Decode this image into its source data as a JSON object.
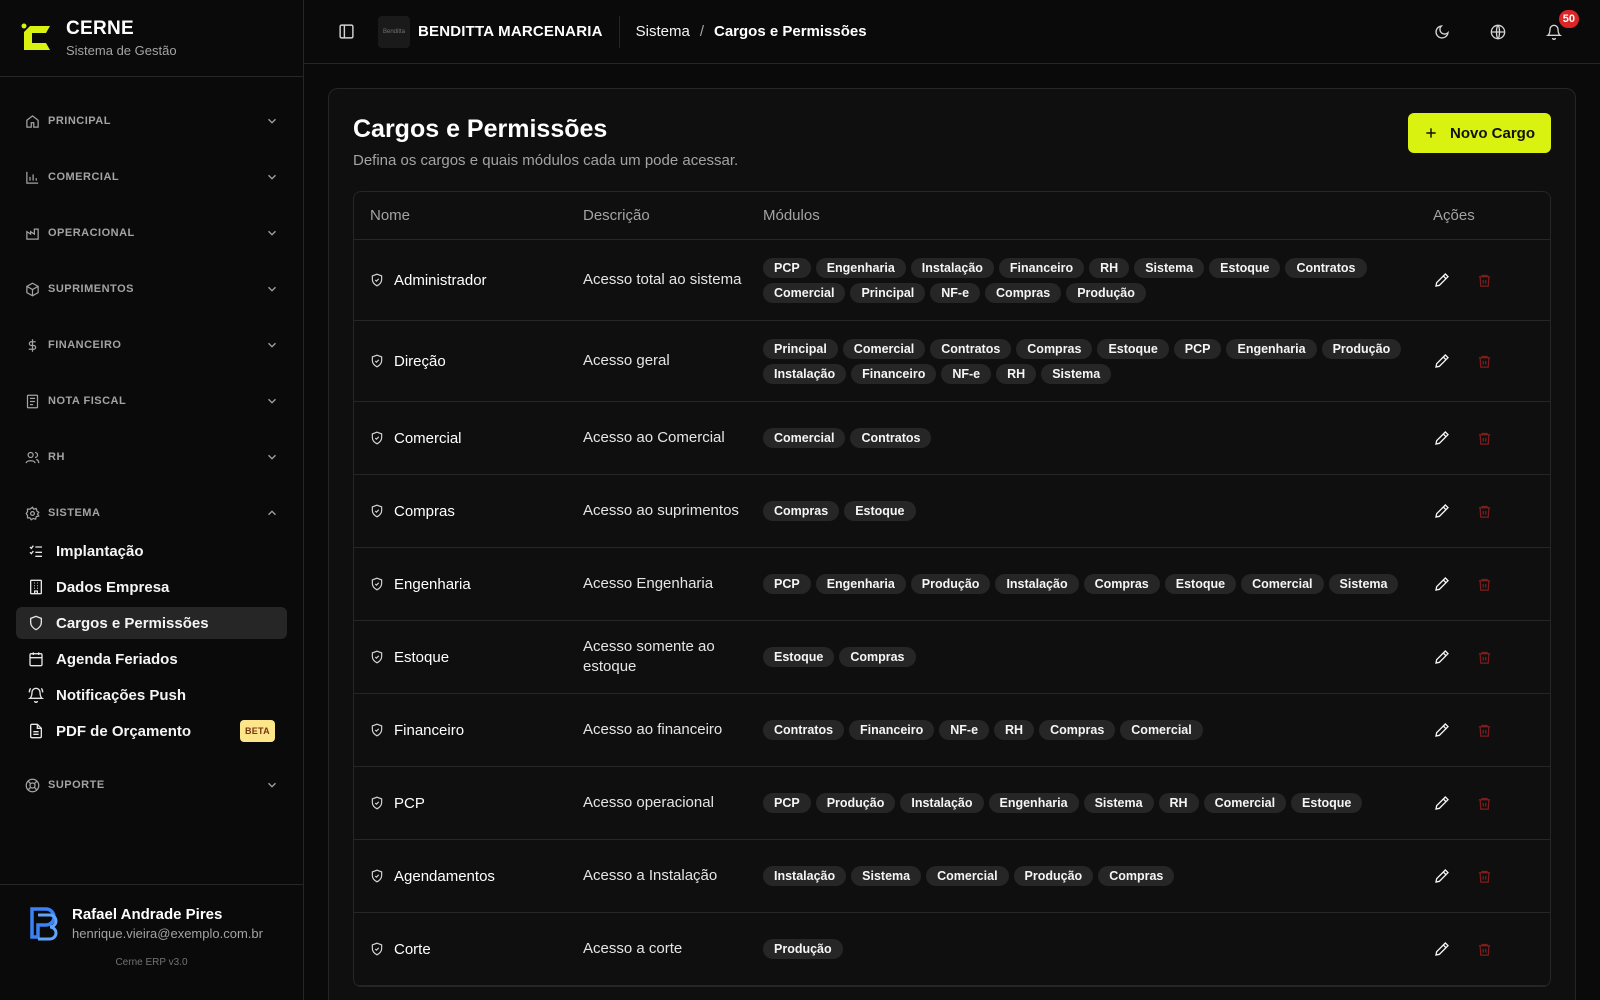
{
  "brand": {
    "name": "CERNE",
    "subtitle": "Sistema de Gestão"
  },
  "sidebar": {
    "sections": [
      {
        "label": "PRINCIPAL",
        "icon": "home-icon"
      },
      {
        "label": "COMERCIAL",
        "icon": "bar-chart-icon"
      },
      {
        "label": "OPERACIONAL",
        "icon": "factory-icon"
      },
      {
        "label": "SUPRIMENTOS",
        "icon": "package-icon"
      },
      {
        "label": "FINANCEIRO",
        "icon": "dollar-icon"
      },
      {
        "label": "NOTA FISCAL",
        "icon": "receipt-icon"
      },
      {
        "label": "RH",
        "icon": "users-icon"
      },
      {
        "label": "SISTEMA",
        "icon": "gear-icon"
      },
      {
        "label": "SUPORTE",
        "icon": "lifebuoy-icon"
      }
    ],
    "system_items": [
      {
        "label": "Implantação",
        "icon": "checklist-icon"
      },
      {
        "label": "Dados Empresa",
        "icon": "building-icon"
      },
      {
        "label": "Cargos e Permissões",
        "icon": "shield-icon",
        "active": true
      },
      {
        "label": "Agenda Feriados",
        "icon": "calendar-icon"
      },
      {
        "label": "Notificações Push",
        "icon": "bell-ring-icon"
      },
      {
        "label": "PDF de Orçamento",
        "icon": "file-icon",
        "badge": "BETA"
      }
    ]
  },
  "user": {
    "name": "Rafael Andrade Pires",
    "email": "henrique.vieira@exemplo.com.br"
  },
  "version": "Cerne ERP v3.0",
  "topbar": {
    "company": "BENDITTA MARCENARIA",
    "company_logo_text": "Benditta",
    "breadcrumb_root": "Sistema",
    "breadcrumb_sep": "/",
    "breadcrumb_current": "Cargos e Permissões",
    "notifications_count": "50"
  },
  "page": {
    "title": "Cargos e Permissões",
    "subtitle": "Defina os cargos e quais módulos cada um pode acessar.",
    "new_button": "Novo Cargo"
  },
  "table": {
    "headers": {
      "name": "Nome",
      "description": "Descrição",
      "modules": "Módulos",
      "actions": "Ações"
    },
    "rows": [
      {
        "name": "Administrador",
        "description": "Acesso total ao sistema",
        "modules": [
          "PCP",
          "Engenharia",
          "Instalação",
          "Financeiro",
          "RH",
          "Sistema",
          "Estoque",
          "Contratos",
          "Comercial",
          "Principal",
          "NF-e",
          "Compras",
          "Produção"
        ]
      },
      {
        "name": "Direção",
        "description": "Acesso geral",
        "modules": [
          "Principal",
          "Comercial",
          "Contratos",
          "Compras",
          "Estoque",
          "PCP",
          "Engenharia",
          "Produção",
          "Instalação",
          "Financeiro",
          "NF-e",
          "RH",
          "Sistema"
        ]
      },
      {
        "name": "Comercial",
        "description": "Acesso ao Comercial",
        "modules": [
          "Comercial",
          "Contratos"
        ]
      },
      {
        "name": "Compras",
        "description": "Acesso ao suprimentos",
        "modules": [
          "Compras",
          "Estoque"
        ]
      },
      {
        "name": "Engenharia",
        "description": "Acesso Engenharia",
        "modules": [
          "PCP",
          "Engenharia",
          "Produção",
          "Instalação",
          "Compras",
          "Estoque",
          "Comercial",
          "Sistema"
        ]
      },
      {
        "name": "Estoque",
        "description": "Acesso somente ao estoque",
        "modules": [
          "Estoque",
          "Compras"
        ]
      },
      {
        "name": "Financeiro",
        "description": "Acesso ao financeiro",
        "modules": [
          "Contratos",
          "Financeiro",
          "NF-e",
          "RH",
          "Compras",
          "Comercial"
        ]
      },
      {
        "name": "PCP",
        "description": "Acesso operacional",
        "modules": [
          "PCP",
          "Produção",
          "Instalação",
          "Engenharia",
          "Sistema",
          "RH",
          "Comercial",
          "Estoque"
        ]
      },
      {
        "name": "Agendamentos",
        "description": "Acesso a Instalação",
        "modules": [
          "Instalação",
          "Sistema",
          "Comercial",
          "Produção",
          "Compras"
        ]
      },
      {
        "name": "Corte",
        "description": "Acesso a corte",
        "modules": [
          "Produção"
        ]
      }
    ]
  },
  "colors": {
    "accent": "#d9f20f",
    "danger": "#7f1d1d",
    "badge": "#dc2626"
  }
}
